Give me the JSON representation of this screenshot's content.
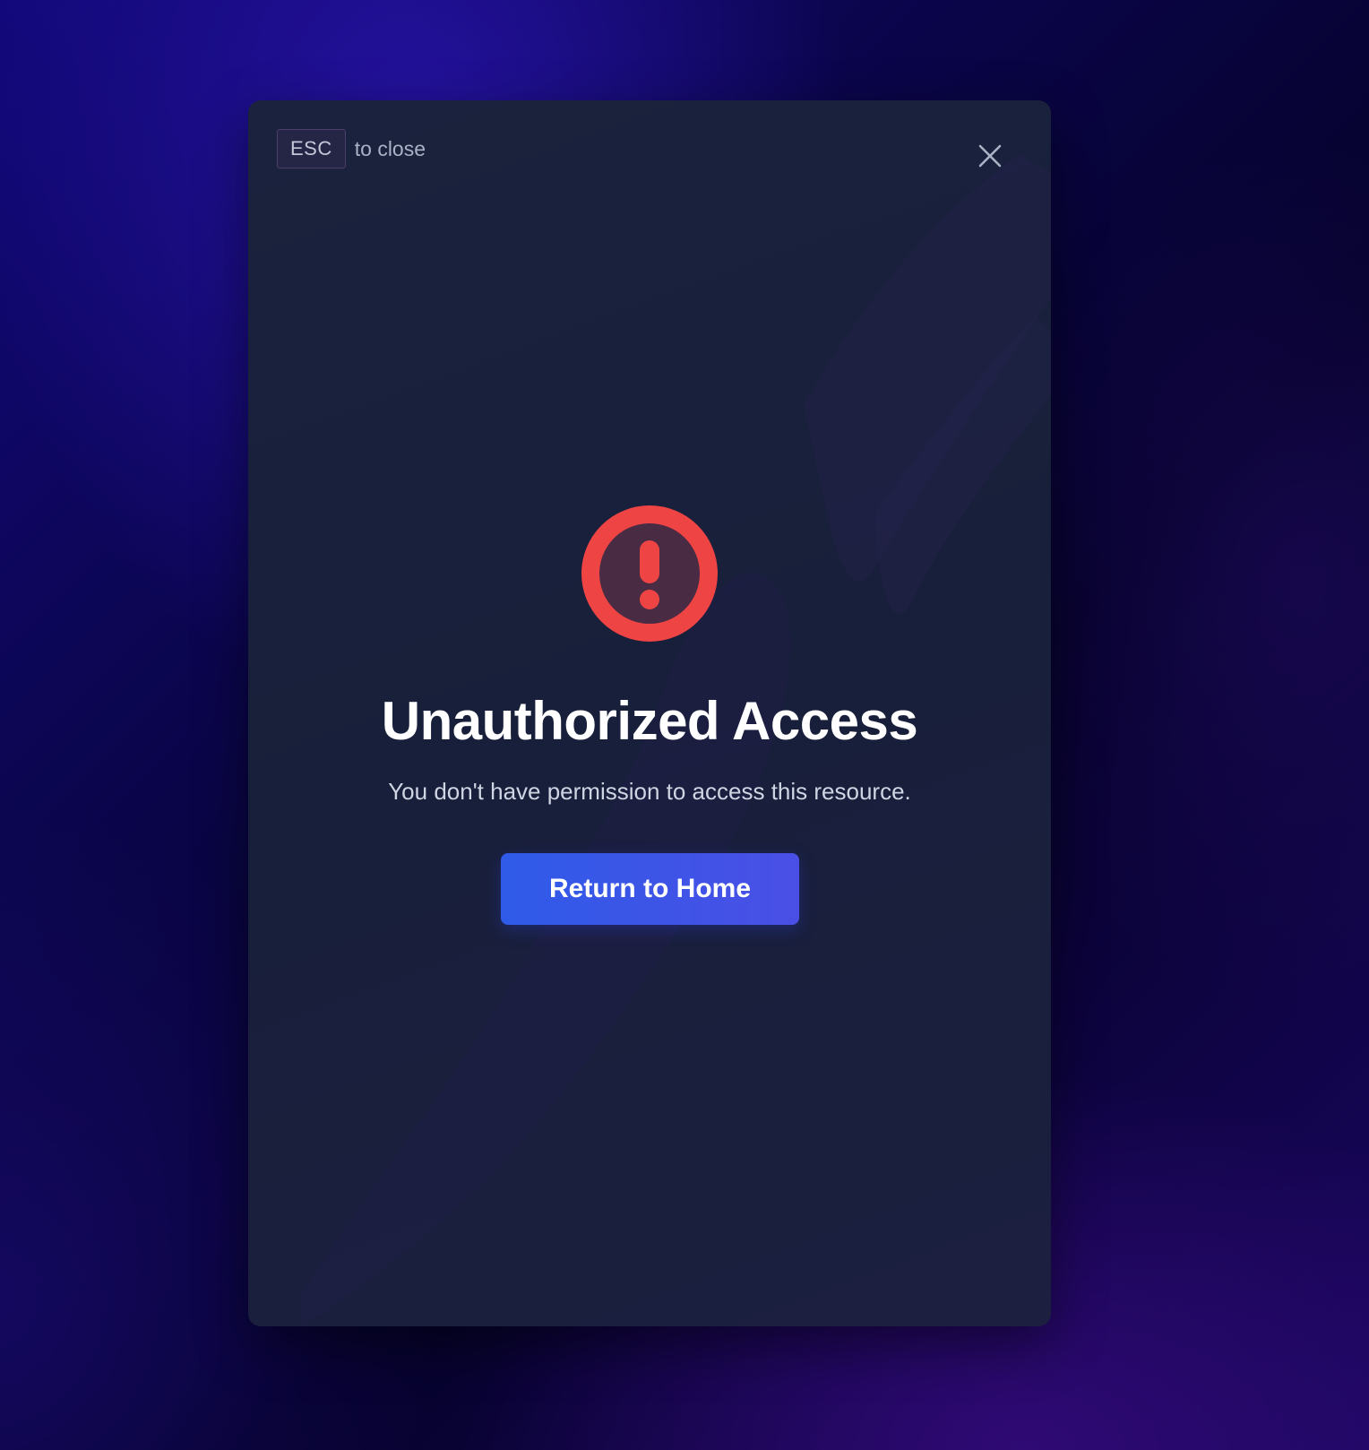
{
  "modal": {
    "esc_key": "ESC",
    "esc_hint": "to close",
    "close_icon": "close-icon",
    "alert_icon": "exclamation-circle-icon",
    "title": "Unauthorized Access",
    "message": "You don't have permission to access this resource.",
    "button_label": "Return to Home"
  },
  "colors": {
    "alert_red": "#ef4444",
    "button_blue": "#3b5bea",
    "modal_bg": "#1a223d"
  }
}
